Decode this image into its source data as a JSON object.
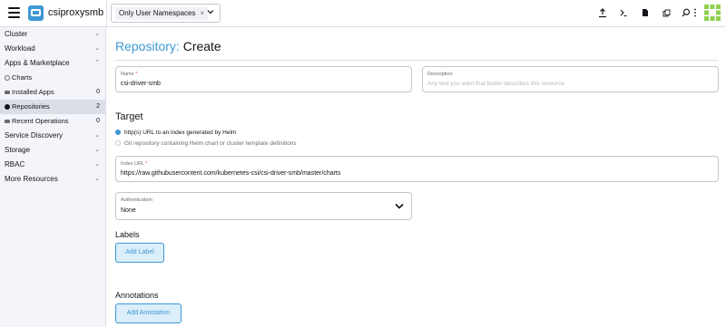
{
  "header": {
    "cluster_name": "csiproxysmb",
    "namespace_filter": {
      "chip_label": "Only User Namespaces",
      "chip_remove": "×"
    },
    "icons": [
      "import-yaml-icon",
      "kubectl-shell-icon",
      "kubeconfig-download-icon",
      "copy-kubeconfig-icon",
      "search-icon",
      "more-actions-icon"
    ],
    "accent": "#3d98d3"
  },
  "sidebar": {
    "groups": [
      {
        "label": "Cluster",
        "chevron": "⌄"
      },
      {
        "label": "Workload",
        "chevron": "⌄"
      },
      {
        "label": "Apps & Marketplace",
        "chevron": "⌃"
      },
      {
        "label": "Service Discovery",
        "chevron": "⌄"
      },
      {
        "label": "Storage",
        "chevron": "⌄"
      },
      {
        "label": "RBAC",
        "chevron": "⌄"
      },
      {
        "label": "More Resources",
        "chevron": "⌄"
      }
    ],
    "apps_items": [
      {
        "label": "Charts",
        "count": ""
      },
      {
        "label": "Installed Apps",
        "count": "0"
      },
      {
        "label": "Repositories",
        "count": "2"
      },
      {
        "label": "Recent Operations",
        "count": "0"
      }
    ]
  },
  "main": {
    "title_link": "Repository:",
    "title_rest": " Create",
    "name_field": {
      "label": "Name",
      "required": "*",
      "value": "csi-driver-smb"
    },
    "description_field": {
      "label": "Description",
      "placeholder": "Any text you want that better describes this resource"
    },
    "target": {
      "title": "Target",
      "options": [
        {
          "label": "http(s) URL to an index generated by Helm",
          "selected": true
        },
        {
          "label": "Git repository containing Helm chart or cluster template definitions",
          "selected": false
        }
      ]
    },
    "index_url_field": {
      "label": "Index URL",
      "required": "*",
      "value": "https://raw.githubusercontent.com/kubernetes-csi/csi-driver-smb/master/charts"
    },
    "authentication_field": {
      "label": "Authentication",
      "value": "None"
    },
    "labels": {
      "title": "Labels",
      "add_button": "Add Label"
    },
    "annotations": {
      "title": "Annotations",
      "add_button": "Add Annotation"
    }
  }
}
